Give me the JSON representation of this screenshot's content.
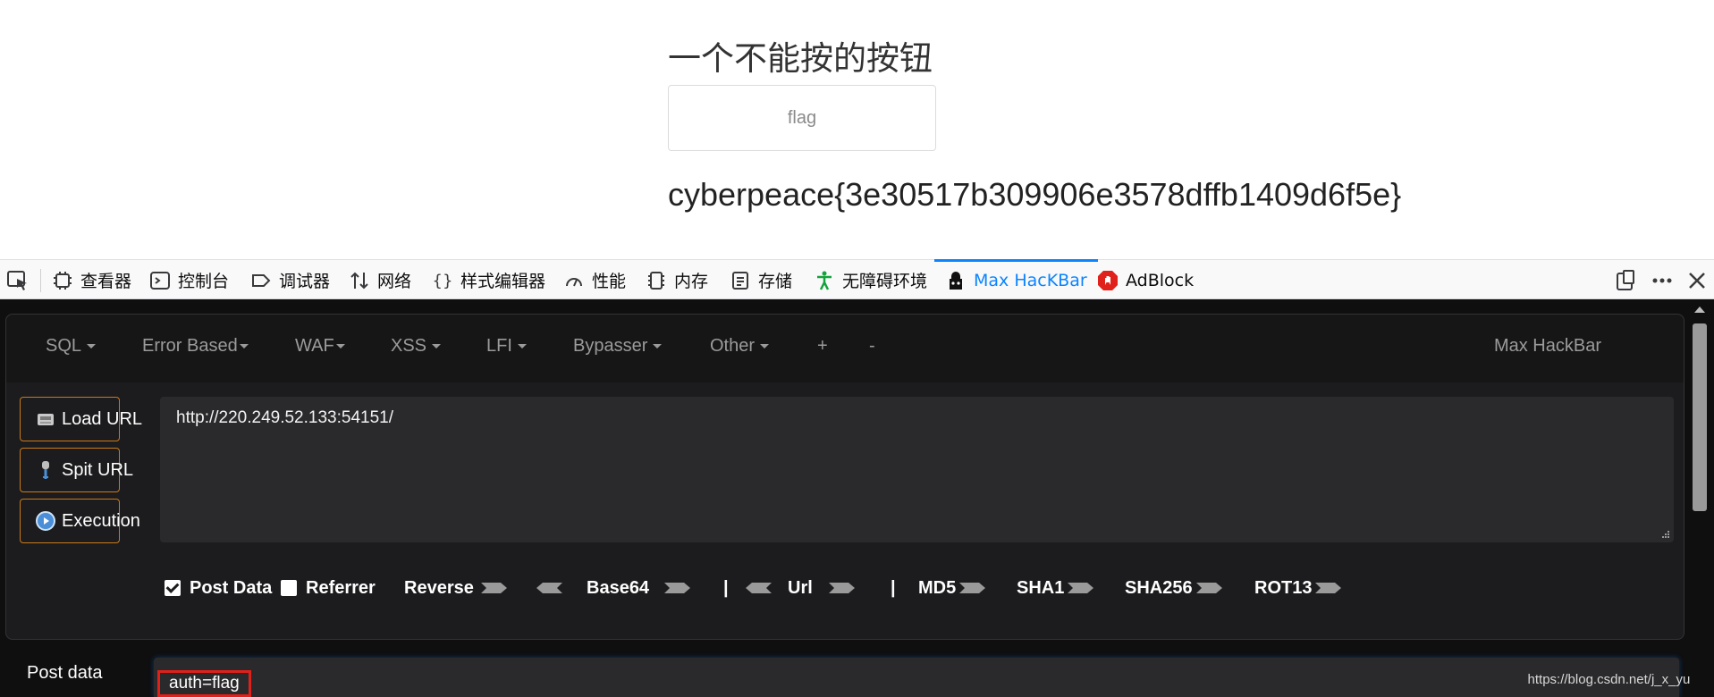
{
  "page": {
    "title": "一个不能按的按钮",
    "flag_button_label": "flag",
    "flag_text": "cyberpeace{3e30517b309906e3578dffb1409d6f5e}"
  },
  "devtools": {
    "tabs": [
      {
        "label": "查看器",
        "icon": "inspector-icon"
      },
      {
        "label": "控制台",
        "icon": "console-icon"
      },
      {
        "label": "调试器",
        "icon": "debugger-icon"
      },
      {
        "label": "网络",
        "icon": "network-icon"
      },
      {
        "label": "样式编辑器",
        "icon": "style-editor-icon"
      },
      {
        "label": "性能",
        "icon": "performance-icon"
      },
      {
        "label": "内存",
        "icon": "memory-icon"
      },
      {
        "label": "存储",
        "icon": "storage-icon"
      },
      {
        "label": "无障碍环境",
        "icon": "accessibility-icon"
      },
      {
        "label": "Max HacKBar",
        "icon": "hackbar-icon"
      },
      {
        "label": "AdBlock",
        "icon": "adblock-icon"
      }
    ],
    "active_tab": "Max HacKBar",
    "colors": {
      "accent": "#0a84ff",
      "adblock": "#e0201a",
      "accessibility": "#12a33a"
    }
  },
  "hackbar": {
    "menu": [
      "SQL",
      "Error Based",
      "WAF",
      "XSS",
      "LFI",
      "Bypasser",
      "Other",
      "+",
      "-"
    ],
    "brand": "Max HackBar",
    "buttons": {
      "load_url": "Load URL",
      "split_url": "Spit URL",
      "execution": "Execution"
    },
    "url_value": "http://220.249.52.133:54151/",
    "options": {
      "post_data": "Post Data",
      "post_data_checked": true,
      "referrer": "Referrer",
      "referrer_checked": false,
      "reverse": "Reverse",
      "base64": "Base64",
      "separator": "|",
      "url": "Url",
      "md5": "MD5",
      "sha1": "SHA1",
      "sha256": "SHA256",
      "rot13": "ROT13"
    },
    "post_label": "Post data",
    "post_value": "auth=flag",
    "border_color": "#c87a1a",
    "highlight_color": "#e0201a"
  },
  "watermark": "https://blog.csdn.net/j_x_yuan"
}
